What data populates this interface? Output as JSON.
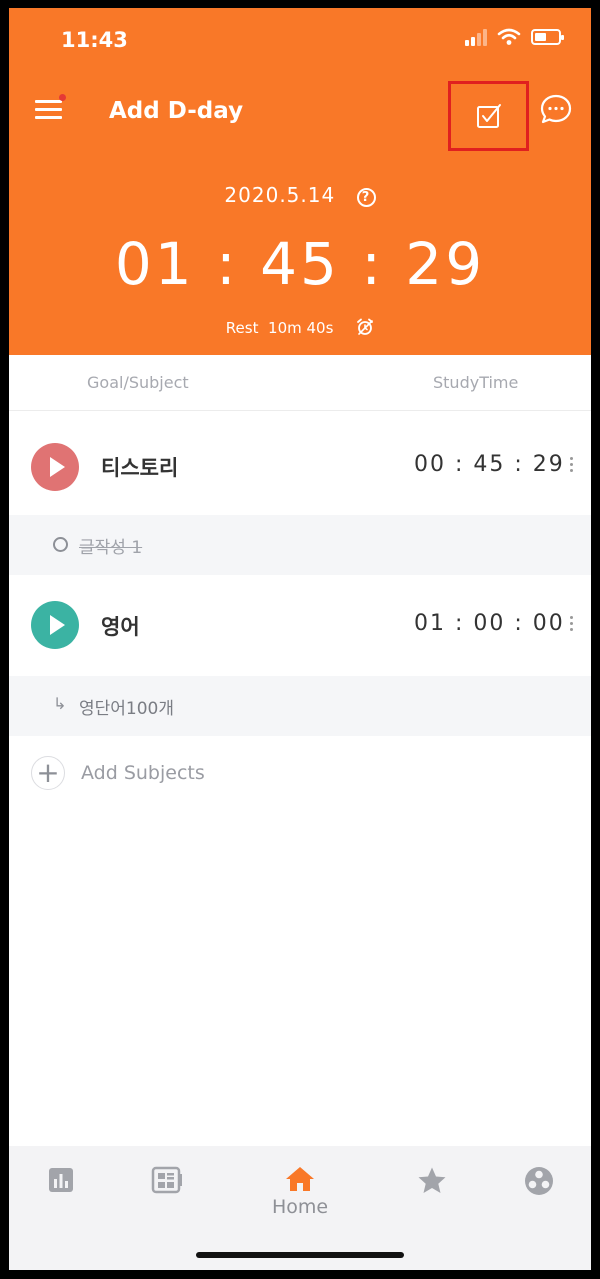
{
  "status_bar": {
    "time": "11:43"
  },
  "header": {
    "title": "Add D-day",
    "date": "2020.5.14",
    "help_symbol": "?",
    "total_time": "01 : 45 : 29",
    "rest_label": "Rest",
    "rest_time": "10m 40s"
  },
  "columns": {
    "left": "Goal/Subject",
    "right": "StudyTime"
  },
  "subjects": [
    {
      "name": "티스토리",
      "time": "00 : 45 : 29",
      "color": "#e07373",
      "goal": "글작성 1",
      "goal_done": true
    },
    {
      "name": "영어",
      "time": "01 : 00 : 00",
      "color": "#3bb3a3",
      "goal": "영단어100개",
      "goal_done": false
    }
  ],
  "add_subjects_label": "Add Subjects",
  "tabbar": {
    "items": [
      {
        "icon": "bar-chart-icon",
        "label": ""
      },
      {
        "icon": "planner-icon",
        "label": ""
      },
      {
        "icon": "home-icon",
        "label": "Home",
        "active": true
      },
      {
        "icon": "star-icon",
        "label": ""
      },
      {
        "icon": "group-icon",
        "label": ""
      }
    ]
  },
  "colors": {
    "accent": "#f97828",
    "highlight_box": "#e0201f"
  }
}
